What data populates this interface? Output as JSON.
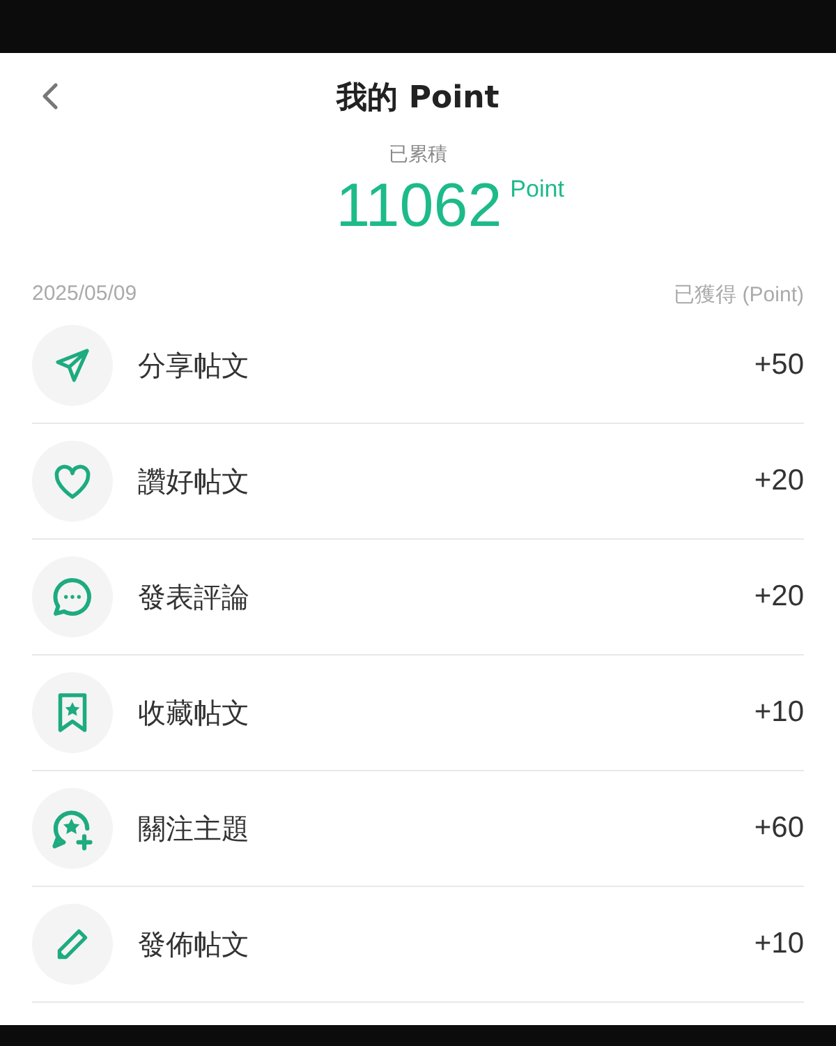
{
  "header": {
    "title": "我的 Point"
  },
  "summary": {
    "label": "已累積",
    "value": "11062",
    "unit": "Point"
  },
  "list_header": {
    "date": "2025/05/09",
    "column": "已獲得 (Point)"
  },
  "items": [
    {
      "kind": "share",
      "label": "分享帖文",
      "points": "+50"
    },
    {
      "kind": "like",
      "label": "讚好帖文",
      "points": "+20"
    },
    {
      "kind": "comment",
      "label": "發表評論",
      "points": "+20"
    },
    {
      "kind": "bookmark",
      "label": "收藏帖文",
      "points": "+10"
    },
    {
      "kind": "follow",
      "label": "關注主題",
      "points": "+60"
    },
    {
      "kind": "post",
      "label": "發佈帖文",
      "points": "+10"
    }
  ]
}
